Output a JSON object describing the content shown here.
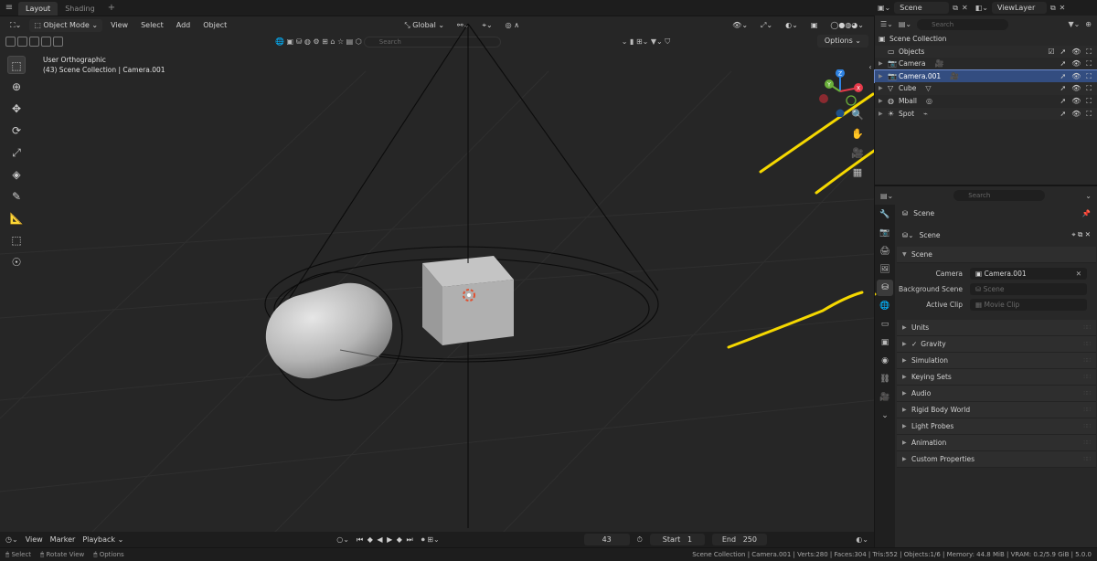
{
  "topbar": {
    "tabs": [
      "Layout",
      "Shading"
    ],
    "add": "+"
  },
  "scenebar": {
    "scene": "Scene",
    "view_layer": "ViewLayer"
  },
  "viewport": {
    "mode": "Object Mode",
    "menus": [
      "View",
      "Select",
      "Add",
      "Object"
    ],
    "transform_orientation": "Global",
    "search_placeholder": "Search",
    "options": "Options",
    "info_line1": "User Orthographic",
    "info_line2": "(43) Scene Collection | Camera.001",
    "gizmo": {
      "z": "Z",
      "y": "Y",
      "x": "X"
    }
  },
  "outliner": {
    "search_placeholder": "Search",
    "collection": "Scene Collection",
    "items": [
      {
        "name": "Objects",
        "icon": "collection-icon"
      },
      {
        "name": "Camera",
        "icon": "camera-icon"
      },
      {
        "name": "Camera.001",
        "icon": "camera-icon"
      },
      {
        "name": "Cube",
        "icon": "cube-icon"
      },
      {
        "name": "Mball",
        "icon": "metaball-icon"
      },
      {
        "name": "Spot",
        "icon": "light-icon"
      }
    ]
  },
  "properties": {
    "search_placeholder": "Search",
    "context": "Scene",
    "datablock": "Scene",
    "panel_scene": "Scene",
    "camera_label": "Camera",
    "camera_value": "Camera.001",
    "bg_scene_label": "Background Scene",
    "bg_scene_placeholder": "Scene",
    "active_clip_label": "Active Clip",
    "active_clip_placeholder": "Movie Clip",
    "panels": [
      "Units",
      "Gravity",
      "Simulation",
      "Keying Sets",
      "Audio",
      "Rigid Body World",
      "Light Probes",
      "Animation",
      "Custom Properties"
    ]
  },
  "timeline": {
    "menus": [
      "View",
      "Marker",
      "Playback"
    ],
    "current_frame": "43",
    "start_label": "Start",
    "start_value": "1",
    "end_label": "End",
    "end_value": "250"
  },
  "statusbar": {
    "select": "Select",
    "rotate": "Rotate View",
    "options": "Options",
    "stats": "Scene Collection | Camera.001 | Verts:280 | Faces:304 | Tris:552 | Objects:1/6 | Memory: 44.8 MiB | VRAM: 0.2/5.9 GiB | 5.0.0"
  }
}
